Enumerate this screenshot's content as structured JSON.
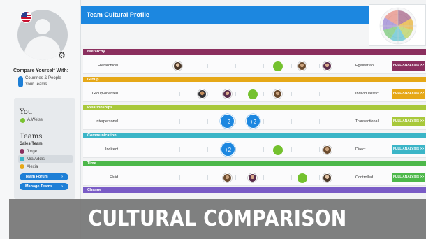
{
  "sidebar": {
    "compare_title": "Compare Yourself With:",
    "compare_option_1": "Countries & People",
    "compare_option_2": "Your Teams",
    "you_title": "You",
    "you_name": "A.Weiss",
    "teams_title": "Teams",
    "team_name": "Sales Team",
    "members": [
      {
        "name": "Jorge",
        "color": "#8b2f5e"
      },
      {
        "name": "Mia Addis",
        "color": "#3bb5c7"
      },
      {
        "name": "Alexia",
        "color": "#e6a817"
      }
    ],
    "forum_button": "Team Forum",
    "manage_button": "Manage Teams",
    "chevron": "›"
  },
  "header": {
    "title": "Team Cultural Profile"
  },
  "full_analysis_label": "FULL ANALYSIS >>",
  "dimensions": [
    {
      "name": "Hierarchy",
      "color": "#8b2f5e",
      "left": "Hierarchical",
      "right": "Egalitarian"
    },
    {
      "name": "Group",
      "color": "#e6a817",
      "left": "Group-oriented",
      "right": "Individualistic"
    },
    {
      "name": "Relationships",
      "color": "#a8c83a",
      "left": "Interpersonal",
      "right": "Transactional"
    },
    {
      "name": "Communication",
      "color": "#3bb5c7",
      "left": "Indirect",
      "right": "Direct"
    },
    {
      "name": "Time",
      "color": "#4db84a",
      "left": "Fluid",
      "right": "Controlled"
    },
    {
      "name": "Change",
      "color": "#7a5cc6",
      "left": "",
      "right": ""
    }
  ],
  "markers": {
    "plus_two": "+2"
  },
  "banner": {
    "text": "CULTURAL COMPARISON"
  }
}
